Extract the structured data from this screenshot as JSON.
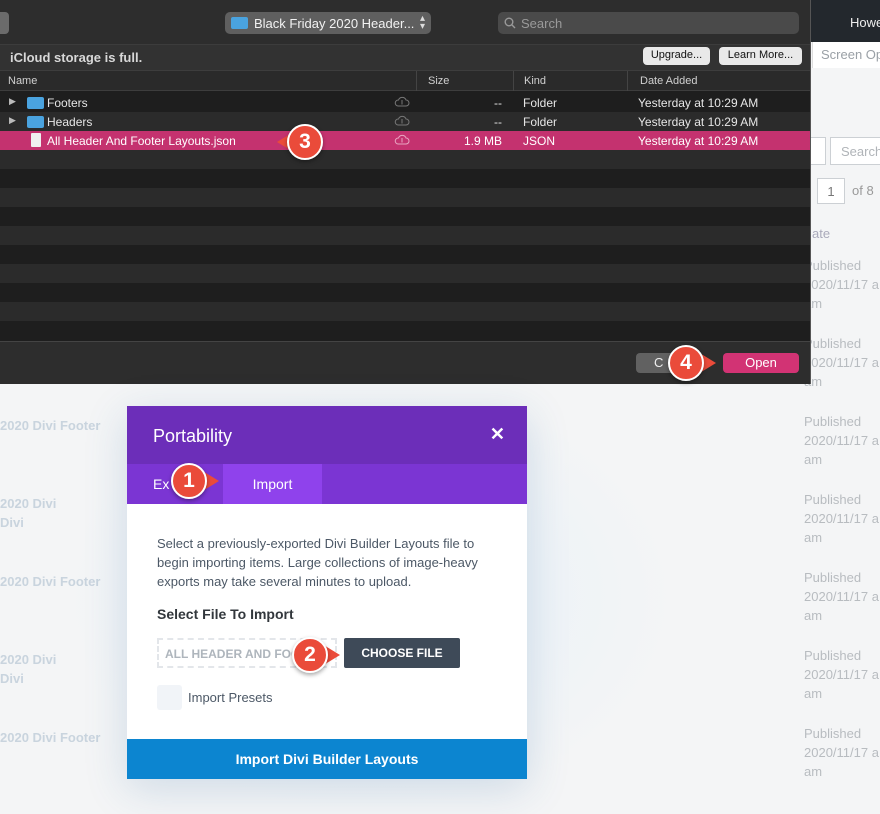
{
  "background": {
    "admin_bar_text": "Howe",
    "screen_options": "Screen Op",
    "search_placeholder": "Search",
    "page_number": "1",
    "page_of": "of 8",
    "date_header": "ate",
    "published_entries": [
      {
        "status": "Published",
        "date": "2020/11/17 a",
        "time": "am"
      },
      {
        "status": "Published",
        "date": "2020/11/17 a",
        "time": "am"
      },
      {
        "status": "Published",
        "date": "2020/11/17 a",
        "time": "am"
      },
      {
        "status": "Published",
        "date": "2020/11/17 a",
        "time": "am"
      },
      {
        "status": "Published",
        "date": "2020/11/17 a",
        "time": "am"
      },
      {
        "status": "Published",
        "date": "2020/11/17 a",
        "time": "am"
      },
      {
        "status": "Published",
        "date": "2020/11/17 a",
        "time": "am"
      }
    ],
    "left_titles": [
      "2020 Divi Footer",
      "2020 Divi",
      "Divi",
      "2020 Divi Footer",
      "2020 Divi",
      "Divi",
      "2020 Divi Footer"
    ]
  },
  "file_dialog": {
    "folder_name": "Black Friday 2020 Header...",
    "search_placeholder": "Search",
    "icloud_message": "iCloud storage is full.",
    "upgrade_label": "Upgrade...",
    "learn_more_label": "Learn More...",
    "columns": {
      "name": "Name",
      "size": "Size",
      "kind": "Kind",
      "date_added": "Date Added"
    },
    "files": [
      {
        "name": "Footers",
        "size": "--",
        "kind": "Folder",
        "date": "Yesterday at 10:29 AM",
        "type": "folder"
      },
      {
        "name": "Headers",
        "size": "--",
        "kind": "Folder",
        "date": "Yesterday at 10:29 AM",
        "type": "folder"
      },
      {
        "name": "All Header And Footer Layouts.json",
        "size": "1.9 MB",
        "kind": "JSON",
        "date": "Yesterday at 10:29 AM",
        "type": "file",
        "selected": true
      }
    ],
    "cancel_label": "C",
    "open_label": "Open"
  },
  "callouts": {
    "one": "1",
    "two": "2",
    "three": "3",
    "four": "4"
  },
  "portability": {
    "title": "Portability",
    "close_glyph": "✕",
    "tab_export": "Ex",
    "tab_import": "Import",
    "description": "Select a previously-exported Divi Builder Layouts file to begin importing items. Large collections of image-heavy exports may take several minutes to upload.",
    "select_file_label": "Select File To Import",
    "file_input_value": "ALL HEADER AND FOOTER LAYOUTS.JSON",
    "choose_file_label": "CHOOSE FILE",
    "import_presets_label": "Import Presets",
    "import_button_label": "Import Divi Builder Layouts"
  },
  "colors": {
    "selection": "#c4326f",
    "open_button": "#d23374",
    "modal_header": "#6c2eb9",
    "modal_tabs": "#7b35d3",
    "import_button": "#0c85d0",
    "callout": "#ea4b3a"
  }
}
